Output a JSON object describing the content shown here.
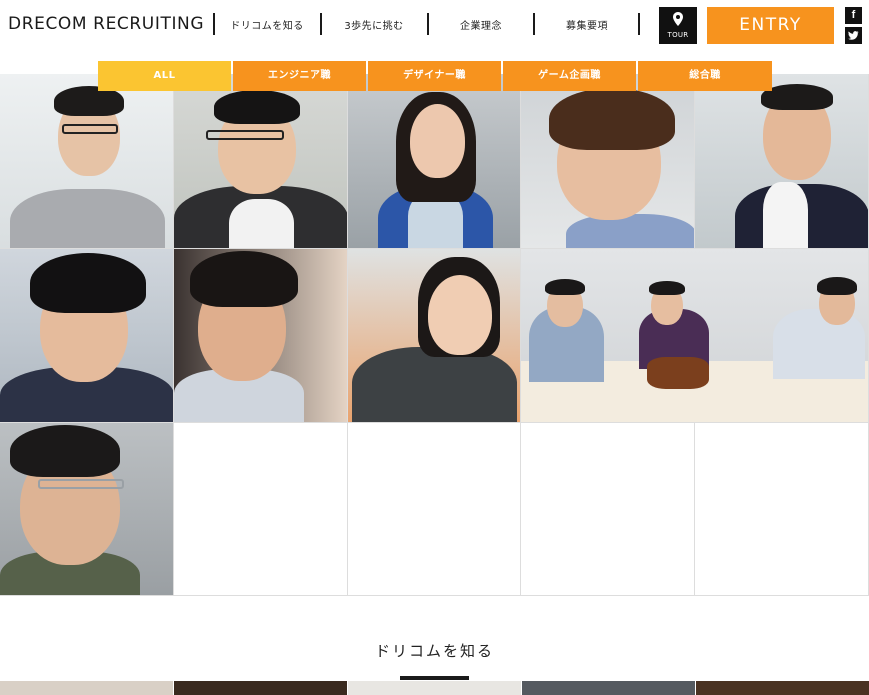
{
  "header": {
    "logo": "DRECOM RECRUITING",
    "nav": [
      "ドリコムを知る",
      "3歩先に挑む",
      "企業理念",
      "募集要項"
    ],
    "tour_label": "TOUR",
    "entry_label": "ENTRY",
    "facebook_glyph": "f",
    "twitter_glyph": "t"
  },
  "filters": {
    "tabs": [
      "ALL",
      "エンジニア職",
      "デザイナー職",
      "ゲーム企画職",
      "総合職"
    ],
    "active": "ALL"
  },
  "section": {
    "title": "ドリコムを知る"
  },
  "colors": {
    "accent": "#f7931e",
    "active_tab": "#fbc531",
    "dark": "#111111"
  }
}
